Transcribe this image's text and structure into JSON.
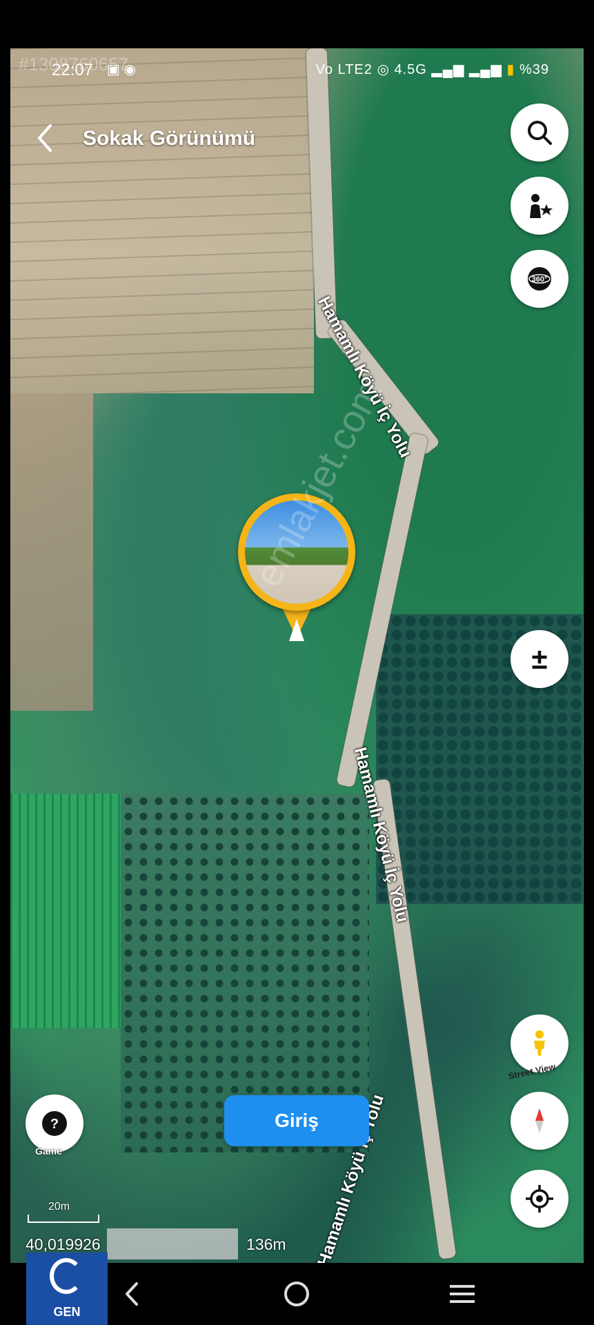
{
  "status_bar": {
    "time": "22:07",
    "network": "Vo LTE2",
    "data_type": "4.5G",
    "battery": "%39"
  },
  "watermark_id": "#1308760657",
  "header": {
    "title": "Sokak Görünümü"
  },
  "map": {
    "road_name": "Hamamlı Köyü İç Yolu",
    "photo_watermark": "emlakjet.com"
  },
  "controls": {
    "street_view_label": "Street View",
    "game_label": "Game",
    "zoom_symbol": "±"
  },
  "giris_button": "Giriş",
  "scale": {
    "label": "20m"
  },
  "coordinates": {
    "value": "40,019926",
    "altitude": "136m"
  },
  "logo": {
    "text": "GEN"
  },
  "icons": [
    "back-icon",
    "search-icon",
    "person-star-icon",
    "360-icon",
    "zoom-icon",
    "street-view-icon",
    "compass-icon",
    "locate-icon",
    "game-icon",
    "nav-back-icon",
    "nav-home-icon",
    "nav-menu-icon"
  ]
}
